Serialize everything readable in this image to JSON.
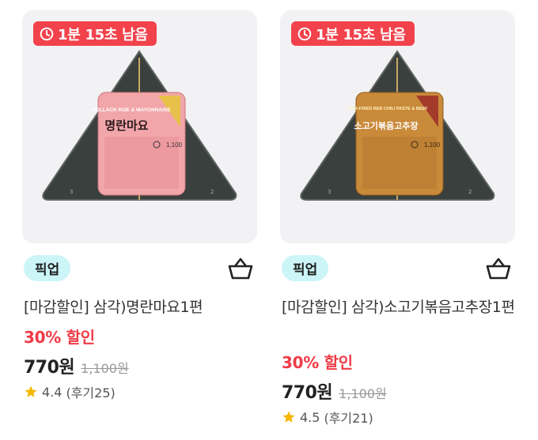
{
  "products": [
    {
      "timer_text": "1분 15초 남음",
      "label_en": "POLLACK ROE & MAYONNAISE",
      "label_ko": "명란마요",
      "label_color": "#f2a6a9",
      "label_price": "1,100",
      "badge": "픽업",
      "title": "[마감할인] 삼각)명란마요1편",
      "discount": "30% 할인",
      "price": "770원",
      "original_price": "1,100원",
      "rating": "4.4",
      "reviews": "(후기25)"
    },
    {
      "timer_text": "1분 15초 남음",
      "label_en": "STIR-FRIED RED CHILI PASTE & BEEF",
      "label_ko": "소고기볶음고추장",
      "label_color": "#c98a3a",
      "label_price": "1,100",
      "badge": "픽업",
      "title": "[마감할인] 삼각)소고기볶음고추장1편",
      "discount": "30% 할인",
      "price": "770원",
      "original_price": "1,100원",
      "rating": "4.5",
      "reviews": "(후기21)"
    }
  ],
  "colors": {
    "timer_bg": "#f2424c",
    "discount": "#f03b46",
    "badge_bg": "#ccf5f8",
    "star": "#f5b800"
  },
  "icons": {
    "timer": "clock-icon",
    "cart": "shopping-basket-icon",
    "rating": "star-icon"
  }
}
